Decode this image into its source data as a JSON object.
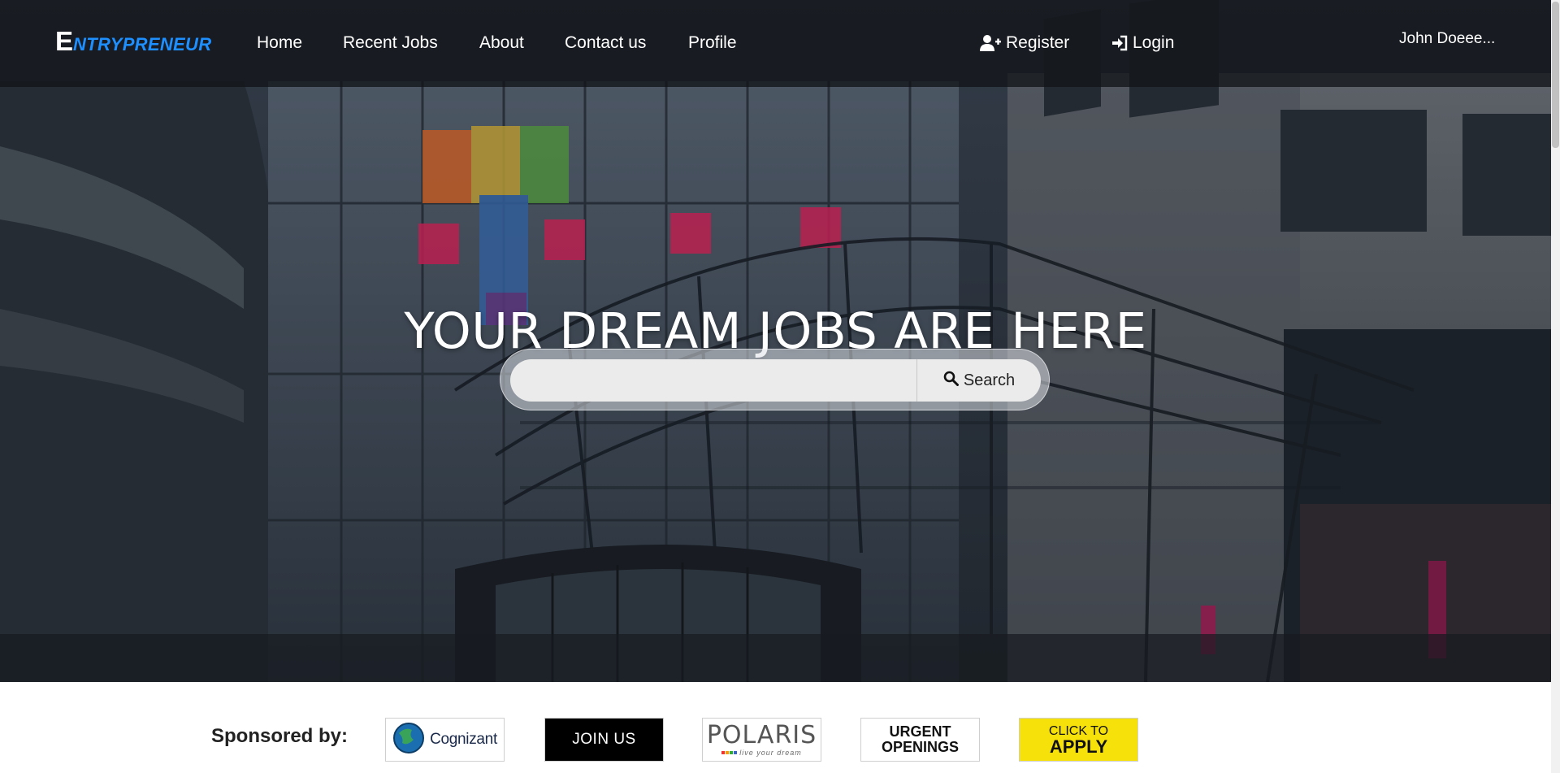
{
  "nav": {
    "brand_first": "E",
    "brand_rest": "NTRYPRENEUR",
    "links": [
      "Home",
      "Recent Jobs",
      "About",
      "Contact us",
      "Profile"
    ],
    "register_label": "Register",
    "login_label": "Login",
    "user_name": "John Doeee..."
  },
  "hero": {
    "headline": "YOUR DREAM JOBS ARE HERE",
    "search_value": "",
    "search_button_label": "Search"
  },
  "sponsors": {
    "label": "Sponsored by:",
    "logos": [
      {
        "name": "Cognizant",
        "text": "Cognizant"
      },
      {
        "name": "Join Us",
        "text": "JOIN US"
      },
      {
        "name": "Polaris",
        "text": "POLARIS",
        "tagline": "live your dream"
      },
      {
        "name": "Urgent Openings",
        "line1": "URGENT",
        "line2": "OPENINGS"
      },
      {
        "name": "Click to Apply",
        "line1": "CLICK TO",
        "line2": "APPLY"
      }
    ]
  },
  "colors": {
    "brand_accent": "#1e8fff",
    "navbar_bg": "#121418",
    "apply_yellow": "#f6e10b"
  },
  "icons": {
    "register": "user-plus-icon",
    "login": "sign-in-icon",
    "search": "search-icon"
  }
}
